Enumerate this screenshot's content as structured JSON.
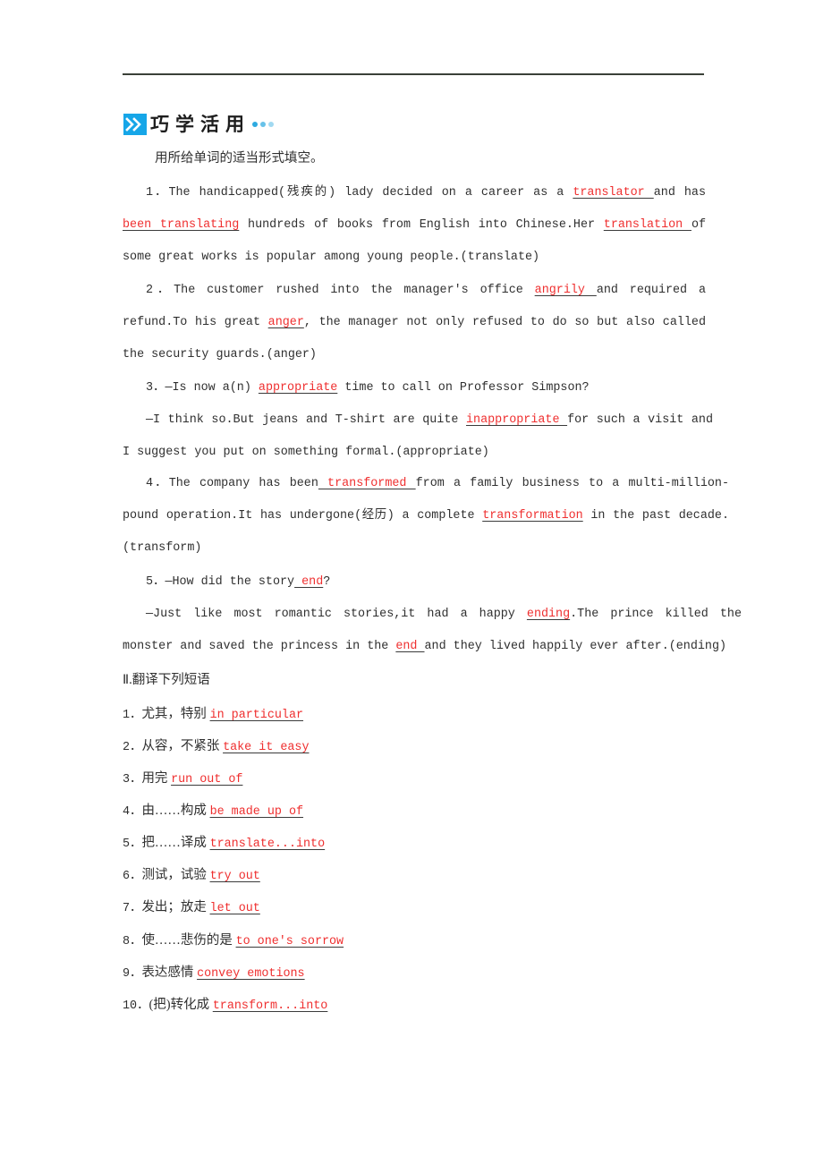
{
  "page": {
    "banner": {
      "chevron_icon": "double-chevron-right-icon",
      "title": "巧学活用",
      "dot_color": "#2eaae0",
      "chevron_bg_color": "#16a6e8"
    },
    "answer_color": "#ef2f2f",
    "rule_color": "#3a4038"
  },
  "section1": {
    "instruction": "用所给单词的适当形式填空。",
    "items": [
      {
        "number": "1．",
        "parts": [
          {
            "t": "The handicapped(残疾的) lady decided on a career as a ",
            "a": false
          },
          {
            "t": "translator ",
            "a": true
          },
          {
            "t": "and has ",
            "a": false
          },
          {
            "t": "been translating",
            "a": true
          },
          {
            "t": " hundreds of books from English into Chinese.Her ",
            "a": false
          },
          {
            "t": "translation ",
            "a": true
          },
          {
            "t": "of some great works is popular among young people.(translate)",
            "a": false
          }
        ]
      },
      {
        "number": "2．",
        "parts": [
          {
            "t": "The customer rushed into the manager's office ",
            "a": false
          },
          {
            "t": "angrily ",
            "a": true
          },
          {
            "t": "and required a refund.To his great ",
            "a": false
          },
          {
            "t": "anger",
            "a": true
          },
          {
            "t": ", the manager not only refused to do so but also called the security guards.(anger)",
            "a": false
          }
        ]
      },
      {
        "number": "3．",
        "parts": [
          {
            "t": "—Is now a(n) ",
            "a": false
          },
          {
            "t": "appropriate",
            "a": true
          },
          {
            "t": " time to call on Professor Simpson?",
            "a": false
          }
        ]
      },
      {
        "number": "",
        "parts": [
          {
            "t": "—I think so.But jeans and T-shirt are quite ",
            "a": false
          },
          {
            "t": "inappropriate ",
            "a": true
          },
          {
            "t": "for such a visit and I suggest you put on something formal.(appropriate)",
            "a": false
          }
        ]
      },
      {
        "number": "4．",
        "parts": [
          {
            "t": "The company has been",
            "a": false
          },
          {
            "t": " transformed ",
            "a": true
          },
          {
            "t": "from a family business to a multi-million-pound operation.It has undergone(经历) a complete ",
            "a": false
          },
          {
            "t": "transformation",
            "a": true
          },
          {
            "t": " in the past decade.(transform)",
            "a": false
          }
        ]
      },
      {
        "number": "5．",
        "parts": [
          {
            "t": "—How did the story",
            "a": false
          },
          {
            "t": " end",
            "a": true
          },
          {
            "t": "?",
            "a": false
          }
        ]
      },
      {
        "number": "",
        "parts": [
          {
            "t": "—Just like most romantic stories,it had a happy ",
            "a": false
          },
          {
            "t": "ending",
            "a": true
          },
          {
            "t": ".The prince killed the monster and saved the princess in the ",
            "a": false
          },
          {
            "t": "end ",
            "a": true
          },
          {
            "t": "and they lived happily ever after.(ending)",
            "a": false
          }
        ]
      }
    ]
  },
  "section2": {
    "title": "Ⅱ.翻译下列短语",
    "items": [
      {
        "number": "1．",
        "cn": "尤其，特别 ",
        "answer": "in particular"
      },
      {
        "number": "2．",
        "cn": "从容，不紧张 ",
        "answer": "take it easy"
      },
      {
        "number": "3．",
        "cn": "用完 ",
        "answer": "run out of"
      },
      {
        "number": "4．",
        "cn": "由……构成 ",
        "answer": "be made up of"
      },
      {
        "number": "5．",
        "cn": "把……译成 ",
        "answer": "translate...into"
      },
      {
        "number": "6．",
        "cn": "测试，试验 ",
        "answer": "try out"
      },
      {
        "number": "7．",
        "cn": "发出；放走 ",
        "answer": "let out"
      },
      {
        "number": "8．",
        "cn": "使……悲伤的是 ",
        "answer": "to one's sorrow"
      },
      {
        "number": "9．",
        "cn": "表达感情 ",
        "answer": "convey emotions"
      },
      {
        "number": "10．",
        "cn": "(把)转化成 ",
        "answer": "transform...into"
      }
    ]
  }
}
